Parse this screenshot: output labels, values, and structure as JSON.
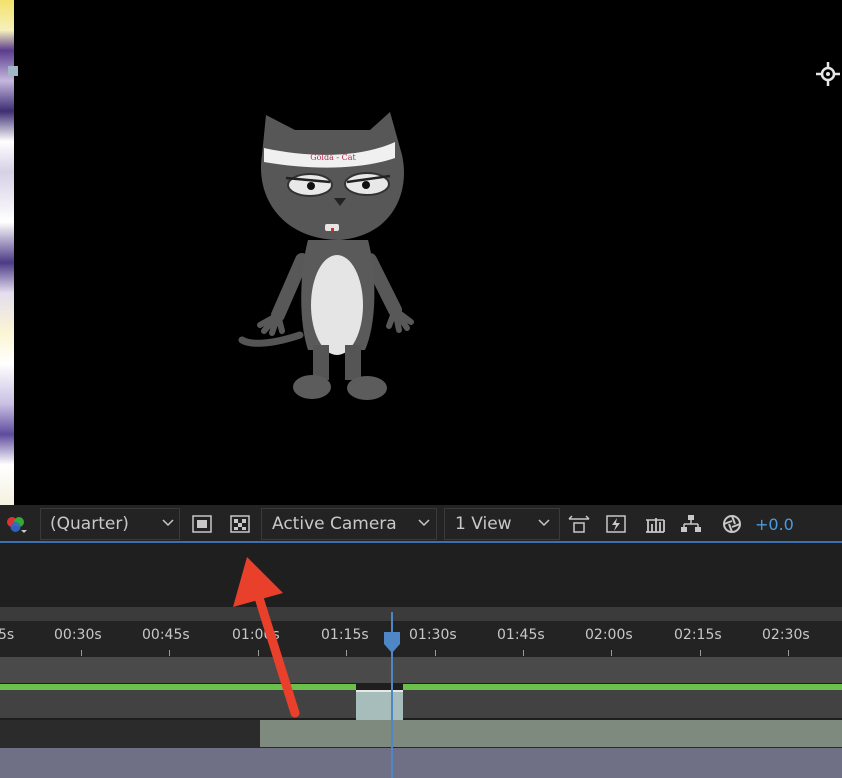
{
  "toolbar": {
    "resolution": "(Quarter)",
    "camera": "Active Camera",
    "views": "1 View",
    "exposure": "+0.0"
  },
  "viewer": {
    "headband_text": "Golda - Cat"
  },
  "ruler": {
    "ticks": [
      "5s",
      "00:30s",
      "00:45s",
      "01:00s",
      "01:15s",
      "01:30s",
      "01:45s",
      "02:00s",
      "02:15s",
      "02:30s"
    ]
  },
  "colors": {
    "accent": "#3a6fb0",
    "exposure_text": "#4b9be0",
    "green_bar": "#6bc04b",
    "arrow": "#e8402a"
  },
  "icons": {
    "channel": "rgb-channel-icon",
    "region": "region-of-interest-icon",
    "transparency": "transparency-grid-icon",
    "fast_preview": "fast-preview-icon",
    "timeline": "timeline-icon",
    "flowchart": "flowchart-icon",
    "exposure": "reset-exposure-icon"
  }
}
